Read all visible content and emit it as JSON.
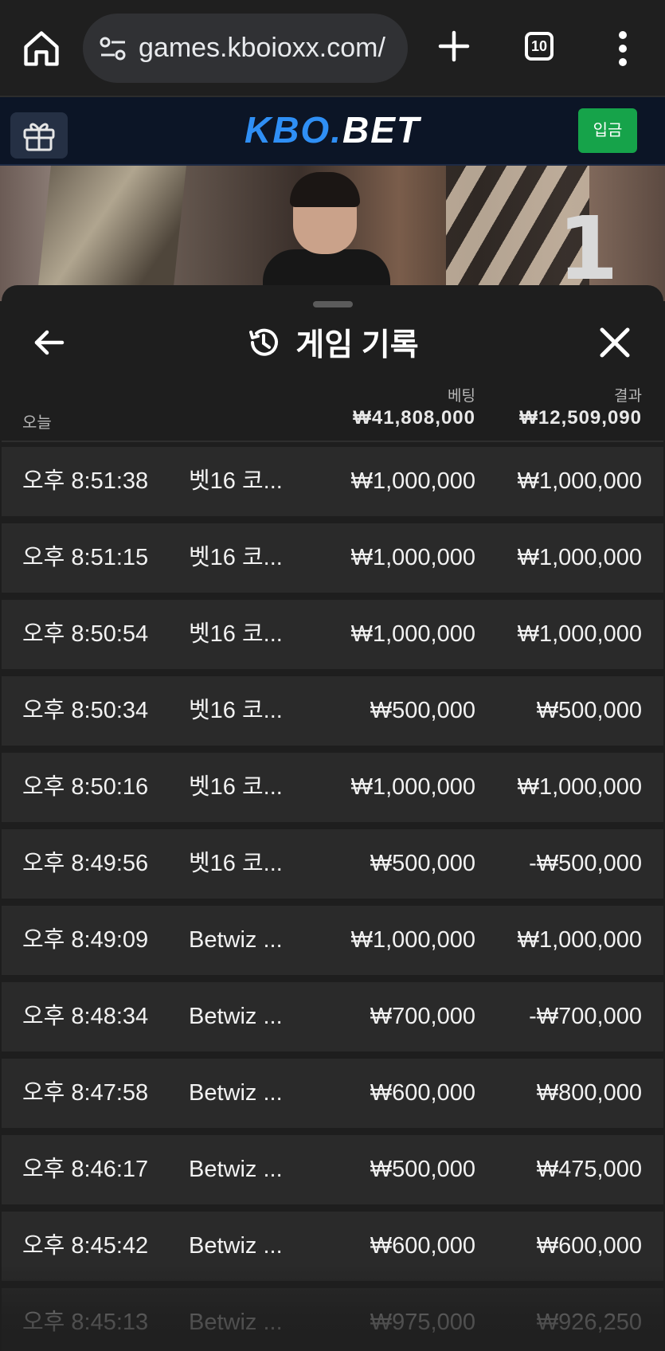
{
  "browser": {
    "url": "games.kboioxx.com/",
    "tab_count": "10"
  },
  "site": {
    "logo_main": "KBO",
    "logo_dot": ".",
    "logo_sub": "BET",
    "deposit_label": "입금"
  },
  "video": {
    "number": "1"
  },
  "sheet": {
    "title": "게임 기록",
    "today_label": "오늘",
    "bet_label": "베팅",
    "bet_total": "₩41,808,000",
    "result_label": "결과",
    "result_total": "₩12,509,090",
    "rows": [
      {
        "time": "오후 8:51:38",
        "game": "벳16 코...",
        "bet": "₩1,000,000",
        "result": "₩1,000,000"
      },
      {
        "time": "오후 8:51:15",
        "game": "벳16 코...",
        "bet": "₩1,000,000",
        "result": "₩1,000,000"
      },
      {
        "time": "오후 8:50:54",
        "game": "벳16 코...",
        "bet": "₩1,000,000",
        "result": "₩1,000,000"
      },
      {
        "time": "오후 8:50:34",
        "game": "벳16 코...",
        "bet": "₩500,000",
        "result": "₩500,000"
      },
      {
        "time": "오후 8:50:16",
        "game": "벳16 코...",
        "bet": "₩1,000,000",
        "result": "₩1,000,000"
      },
      {
        "time": "오후 8:49:56",
        "game": "벳16 코...",
        "bet": "₩500,000",
        "result": "-₩500,000"
      },
      {
        "time": "오후 8:49:09",
        "game": "Betwiz ...",
        "bet": "₩1,000,000",
        "result": "₩1,000,000"
      },
      {
        "time": "오후 8:48:34",
        "game": "Betwiz ...",
        "bet": "₩700,000",
        "result": "-₩700,000"
      },
      {
        "time": "오후 8:47:58",
        "game": "Betwiz ...",
        "bet": "₩600,000",
        "result": "₩800,000"
      },
      {
        "time": "오후 8:46:17",
        "game": "Betwiz ...",
        "bet": "₩500,000",
        "result": "₩475,000"
      },
      {
        "time": "오후 8:45:42",
        "game": "Betwiz ...",
        "bet": "₩600,000",
        "result": "₩600,000"
      },
      {
        "time": "오후 8:45:13",
        "game": "Betwiz ...",
        "bet": "₩975,000",
        "result": "₩926,250"
      }
    ]
  },
  "colors": {
    "logo_blue": "#2f8ff5",
    "deposit_green": "#16a34a",
    "row_bg": "#2a2a2a",
    "sheet_bg": "#1e1e1e"
  },
  "icons": [
    "home-icon",
    "site-settings-icon",
    "plus-icon",
    "tab-switcher-icon",
    "more-vert-icon",
    "gift-icon",
    "arrow-left-icon",
    "history-icon",
    "close-icon"
  ]
}
